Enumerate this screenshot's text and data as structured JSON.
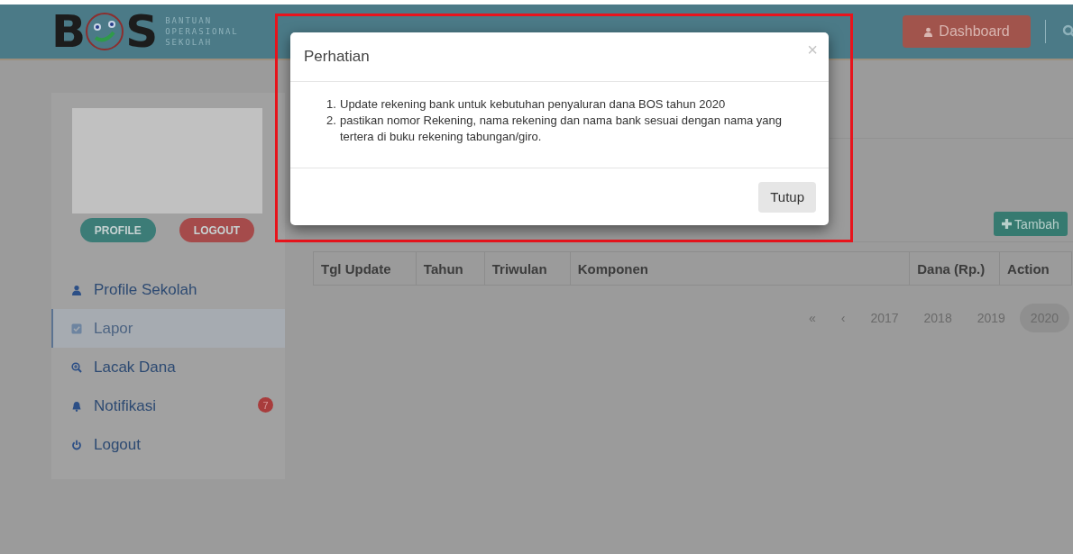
{
  "header": {
    "logo": {
      "left": "B",
      "right": "S"
    },
    "tagline": [
      "BANTUAN",
      "OPERASIONAL",
      "SEKOLAH"
    ],
    "dashboard_button": "Dashboard"
  },
  "sidebar": {
    "buttons": [
      {
        "label": "PROFILE",
        "kind": "profile"
      },
      {
        "label": "LOGOUT",
        "kind": "logout"
      }
    ],
    "items": [
      {
        "label": "Profile Sekolah",
        "kind": "user",
        "selected": false
      },
      {
        "label": "Lapor",
        "kind": "check",
        "selected": true
      },
      {
        "label": "Lacak Dana",
        "kind": "zoom",
        "selected": false
      },
      {
        "label": "Notifikasi",
        "kind": "bell",
        "selected": false,
        "badge": "7"
      },
      {
        "label": "Logout",
        "kind": "power",
        "selected": false
      }
    ]
  },
  "content": {
    "add_button": "Tambah",
    "table": {
      "columns": [
        "Tgl Update",
        "Tahun",
        "Triwulan",
        "Komponen",
        "Dana (Rp.)",
        "Action"
      ]
    },
    "pagination": [
      {
        "label": "«",
        "selected": false
      },
      {
        "label": "‹",
        "selected": false
      },
      {
        "label": "2017",
        "selected": false
      },
      {
        "label": "2018",
        "selected": false
      },
      {
        "label": "2019",
        "selected": false
      },
      {
        "label": "2020",
        "selected": true
      }
    ]
  },
  "modal": {
    "title": "Perhatian",
    "close": "×",
    "items": [
      {
        "number": "1.",
        "text": "Update rekening bank untuk kebutuhan penyaluran dana BOS tahun 2020"
      },
      {
        "number": "2.",
        "text": "pastikan nomor Rekening, nama rekening dan nama bank sesuai dengan nama yang tertera di buku rekening tabungan/giro."
      }
    ],
    "button": "Tutup"
  }
}
